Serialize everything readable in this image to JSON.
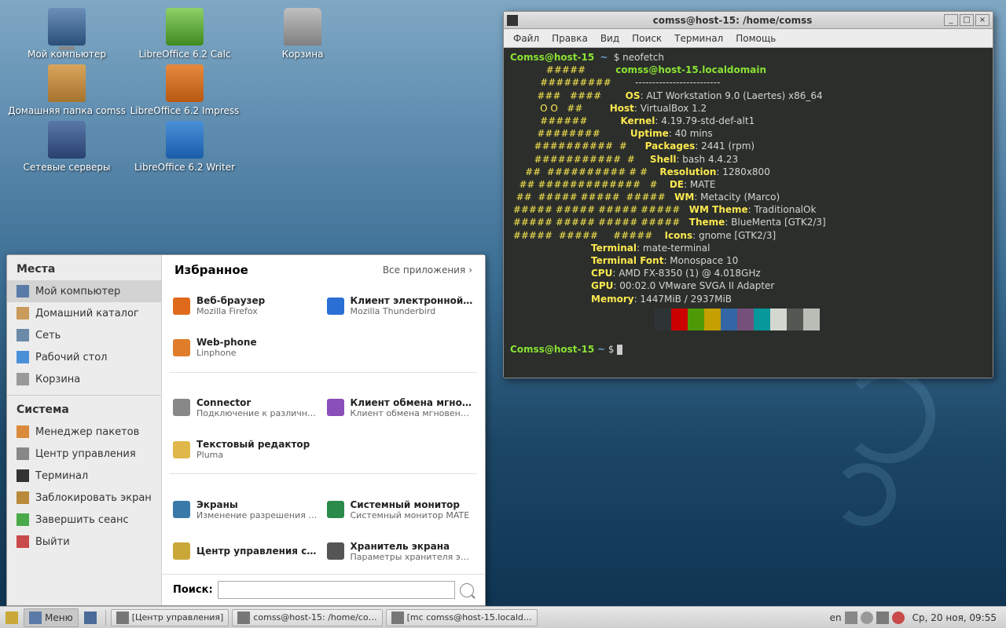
{
  "desktop": {
    "icons": [
      {
        "label": "Мой компьютер"
      },
      {
        "label": "LibreOffice 6.2 Calc"
      },
      {
        "label": "Корзина"
      },
      {
        "label": "Домашняя папка comss"
      },
      {
        "label": "LibreOffice 6.2 Impress"
      },
      {
        "label": "Сетевые серверы"
      },
      {
        "label": "LibreOffice 6.2 Writer"
      }
    ]
  },
  "menu": {
    "places_header": "Места",
    "places": [
      {
        "label": "Мой компьютер"
      },
      {
        "label": "Домашний каталог"
      },
      {
        "label": "Сеть"
      },
      {
        "label": "Рабочий стол"
      },
      {
        "label": "Корзина"
      }
    ],
    "system_header": "Система",
    "system": [
      {
        "label": "Менеджер пакетов"
      },
      {
        "label": "Центр управления"
      },
      {
        "label": "Терминал"
      },
      {
        "label": "Заблокировать экран"
      },
      {
        "label": "Завершить сеанс"
      },
      {
        "label": "Выйти"
      }
    ],
    "fav_header": "Избранное",
    "all_apps": "Все приложения",
    "apps": [
      {
        "t1": "Веб-браузер",
        "t2": "Mozilla Firefox",
        "c": "#e06a1c"
      },
      {
        "t1": "Клиент электронной по…",
        "t2": "Mozilla Thunderbird",
        "c": "#2a6fd4"
      },
      {
        "t1": "Web-phone",
        "t2": "Linphone",
        "c": "#e07d2a"
      },
      {
        "t1": "",
        "t2": "",
        "c": "transparent"
      },
      {
        "t1": "Connector",
        "t2": "Подключение к различны…",
        "c": "#888"
      },
      {
        "t1": "Клиент обмена мгновен…",
        "t2": "Клиент обмена мгновенн…",
        "c": "#8a4fb8"
      },
      {
        "t1": "Текстовый редактор",
        "t2": "Pluma",
        "c": "#e0b84a"
      },
      {
        "t1": "",
        "t2": "",
        "c": "transparent"
      },
      {
        "t1": "Экраны",
        "t2": "Изменение разрешения …",
        "c": "#3a7aa8"
      },
      {
        "t1": "Системный монитор",
        "t2": "Системный монитор MATE",
        "c": "#2a8a4a"
      },
      {
        "t1": "Центр управления сист…",
        "t2": "",
        "c": "#c9a838"
      },
      {
        "t1": "Хранитель экрана",
        "t2": "Параметры хранителя экр…",
        "c": "#555"
      }
    ],
    "search_label": "Поиск:",
    "search_value": ""
  },
  "terminal": {
    "title": "comss@host-15: /home/comss",
    "menus": [
      "Файл",
      "Правка",
      "Вид",
      "Поиск",
      "Терминал",
      "Помощь"
    ],
    "prompt_user": "Comss@host-15",
    "prompt_path": "~",
    "cmd": "neofetch",
    "neofetch": {
      "header": "comss@host-15.localdomain",
      "lines": [
        [
          "OS",
          ": ALT Workstation 9.0 (Laertes) x86_64"
        ],
        [
          "Host",
          ": VirtualBox 1.2"
        ],
        [
          "Kernel",
          ": 4.19.79-std-def-alt1"
        ],
        [
          "Uptime",
          ": 40 mins"
        ],
        [
          "Packages",
          ": 2441 (rpm)"
        ],
        [
          "Shell",
          ": bash 4.4.23"
        ],
        [
          "Resolution",
          ": 1280x800"
        ],
        [
          "DE",
          ": MATE"
        ],
        [
          "WM",
          ": Metacity (Marco)"
        ],
        [
          "WM Theme",
          ": TraditionalOk"
        ],
        [
          "Theme",
          ": BlueMenta [GTK2/3]"
        ],
        [
          "Icons",
          ": gnome [GTK2/3]"
        ],
        [
          "Terminal",
          ": mate-terminal"
        ],
        [
          "Terminal Font",
          ": Monospace 10"
        ],
        [
          "CPU",
          ": AMD FX-8350 (1) @ 4.018GHz"
        ],
        [
          "GPU",
          ": 00:02.0 VMware SVGA II Adapter"
        ],
        [
          "Memory",
          ": 1447MiB / 2937MiB"
        ]
      ],
      "art": [
        "            #####",
        "          #########",
        "         ###   ####",
        "          O O   ##",
        "          ######",
        "         ########",
        "        ##########  #",
        "        ###########  #",
        "     ##  ########## # #",
        "   ## #############   #",
        "  ##  ##### #####  #####",
        " ##### ##### ##### #####",
        " ##### ##### ##### #####",
        " #####  #####     #####"
      ],
      "palette": [
        "#2e3436",
        "#cc0000",
        "#4e9a06",
        "#c4a000",
        "#3465a4",
        "#75507b",
        "#06989a",
        "#d3d7cf",
        "#555753",
        "#babdb6"
      ]
    }
  },
  "taskbar": {
    "menu_label": "Меню",
    "tasks": [
      {
        "label": "[Центр управления]"
      },
      {
        "label": "comss@host-15: /home/co…"
      },
      {
        "label": "[mc  comss@host-15.locald…"
      }
    ],
    "lang": "en",
    "clock": "Ср, 20 ноя, 09:55"
  }
}
